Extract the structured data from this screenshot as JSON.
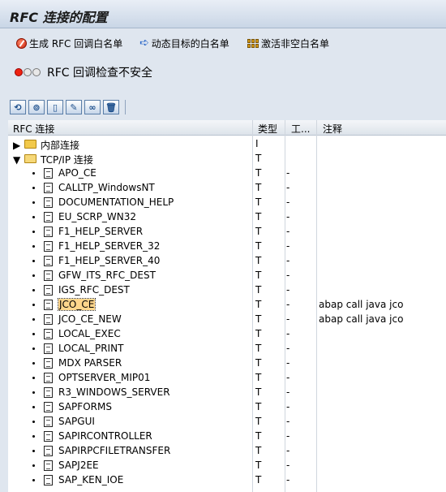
{
  "title": "RFC 连接的配置",
  "appbar": {
    "generate": "生成 RFC 回调白名单",
    "dynamic": "动态目标的白名单",
    "activate": "激活非空白名单"
  },
  "status_text": "RFC 回调检查不安全",
  "grid": {
    "headers": {
      "rfc": "RFC 连接",
      "type": "类型",
      "tool": "工...",
      "comment": "注释"
    },
    "folders": [
      {
        "label": "内部连接",
        "type": "I"
      },
      {
        "label": "TCP/IP 连接",
        "type": "T"
      }
    ],
    "rows": [
      {
        "name": "APO_CE",
        "type": "T",
        "tool": "-",
        "comment": ""
      },
      {
        "name": "CALLTP_WindowsNT",
        "type": "T",
        "tool": "-",
        "comment": ""
      },
      {
        "name": "DOCUMENTATION_HELP",
        "type": "T",
        "tool": "-",
        "comment": ""
      },
      {
        "name": "EU_SCRP_WN32",
        "type": "T",
        "tool": "-",
        "comment": ""
      },
      {
        "name": "F1_HELP_SERVER",
        "type": "T",
        "tool": "-",
        "comment": ""
      },
      {
        "name": "F1_HELP_SERVER_32",
        "type": "T",
        "tool": "-",
        "comment": ""
      },
      {
        "name": "F1_HELP_SERVER_40",
        "type": "T",
        "tool": "-",
        "comment": ""
      },
      {
        "name": "GFW_ITS_RFC_DEST",
        "type": "T",
        "tool": "-",
        "comment": ""
      },
      {
        "name": "IGS_RFC_DEST",
        "type": "T",
        "tool": "-",
        "comment": ""
      },
      {
        "name": "JCO_CE",
        "type": "T",
        "tool": "-",
        "comment": "abap call java jco"
      },
      {
        "name": "JCO_CE_NEW",
        "type": "T",
        "tool": "-",
        "comment": "abap call java jco"
      },
      {
        "name": "LOCAL_EXEC",
        "type": "T",
        "tool": "-",
        "comment": ""
      },
      {
        "name": "LOCAL_PRINT",
        "type": "T",
        "tool": "-",
        "comment": ""
      },
      {
        "name": "MDX PARSER",
        "type": "T",
        "tool": "-",
        "comment": ""
      },
      {
        "name": "OPTSERVER_MIP01",
        "type": "T",
        "tool": "-",
        "comment": ""
      },
      {
        "name": "R3_WINDOWS_SERVER",
        "type": "T",
        "tool": "-",
        "comment": ""
      },
      {
        "name": "SAPFORMS",
        "type": "T",
        "tool": "-",
        "comment": ""
      },
      {
        "name": "SAPGUI",
        "type": "T",
        "tool": "-",
        "comment": ""
      },
      {
        "name": "SAPIRCONTROLLER",
        "type": "T",
        "tool": "-",
        "comment": ""
      },
      {
        "name": "SAPIRPCFILETRANSFER",
        "type": "T",
        "tool": "-",
        "comment": ""
      },
      {
        "name": "SAPJ2EE",
        "type": "T",
        "tool": "-",
        "comment": ""
      },
      {
        "name": "SAP_KEN_IOE",
        "type": "T",
        "tool": "-",
        "comment": ""
      }
    ],
    "selected_row": "JCO_CE"
  },
  "icons": {
    "generate": "red-circle-icon",
    "dynamic": "arrow-right-icon",
    "activate": "grid-icon",
    "toolbar": [
      "refresh-icon",
      "binoculars-icon",
      "new-document-icon",
      "edit-pencil-icon",
      "glasses-icon",
      "trash-icon"
    ]
  }
}
